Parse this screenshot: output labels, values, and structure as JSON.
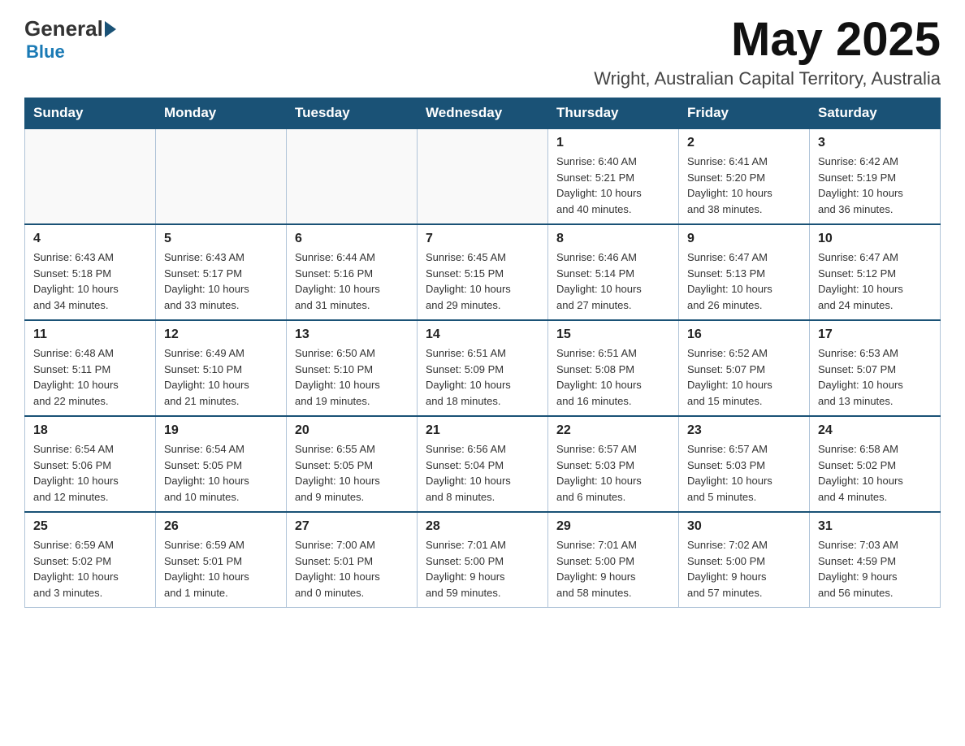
{
  "logo": {
    "general": "General",
    "blue": "Blue"
  },
  "header": {
    "month": "May 2025",
    "location": "Wright, Australian Capital Territory, Australia"
  },
  "weekdays": [
    "Sunday",
    "Monday",
    "Tuesday",
    "Wednesday",
    "Thursday",
    "Friday",
    "Saturday"
  ],
  "weeks": [
    [
      {
        "day": "",
        "info": ""
      },
      {
        "day": "",
        "info": ""
      },
      {
        "day": "",
        "info": ""
      },
      {
        "day": "",
        "info": ""
      },
      {
        "day": "1",
        "info": "Sunrise: 6:40 AM\nSunset: 5:21 PM\nDaylight: 10 hours\nand 40 minutes."
      },
      {
        "day": "2",
        "info": "Sunrise: 6:41 AM\nSunset: 5:20 PM\nDaylight: 10 hours\nand 38 minutes."
      },
      {
        "day": "3",
        "info": "Sunrise: 6:42 AM\nSunset: 5:19 PM\nDaylight: 10 hours\nand 36 minutes."
      }
    ],
    [
      {
        "day": "4",
        "info": "Sunrise: 6:43 AM\nSunset: 5:18 PM\nDaylight: 10 hours\nand 34 minutes."
      },
      {
        "day": "5",
        "info": "Sunrise: 6:43 AM\nSunset: 5:17 PM\nDaylight: 10 hours\nand 33 minutes."
      },
      {
        "day": "6",
        "info": "Sunrise: 6:44 AM\nSunset: 5:16 PM\nDaylight: 10 hours\nand 31 minutes."
      },
      {
        "day": "7",
        "info": "Sunrise: 6:45 AM\nSunset: 5:15 PM\nDaylight: 10 hours\nand 29 minutes."
      },
      {
        "day": "8",
        "info": "Sunrise: 6:46 AM\nSunset: 5:14 PM\nDaylight: 10 hours\nand 27 minutes."
      },
      {
        "day": "9",
        "info": "Sunrise: 6:47 AM\nSunset: 5:13 PM\nDaylight: 10 hours\nand 26 minutes."
      },
      {
        "day": "10",
        "info": "Sunrise: 6:47 AM\nSunset: 5:12 PM\nDaylight: 10 hours\nand 24 minutes."
      }
    ],
    [
      {
        "day": "11",
        "info": "Sunrise: 6:48 AM\nSunset: 5:11 PM\nDaylight: 10 hours\nand 22 minutes."
      },
      {
        "day": "12",
        "info": "Sunrise: 6:49 AM\nSunset: 5:10 PM\nDaylight: 10 hours\nand 21 minutes."
      },
      {
        "day": "13",
        "info": "Sunrise: 6:50 AM\nSunset: 5:10 PM\nDaylight: 10 hours\nand 19 minutes."
      },
      {
        "day": "14",
        "info": "Sunrise: 6:51 AM\nSunset: 5:09 PM\nDaylight: 10 hours\nand 18 minutes."
      },
      {
        "day": "15",
        "info": "Sunrise: 6:51 AM\nSunset: 5:08 PM\nDaylight: 10 hours\nand 16 minutes."
      },
      {
        "day": "16",
        "info": "Sunrise: 6:52 AM\nSunset: 5:07 PM\nDaylight: 10 hours\nand 15 minutes."
      },
      {
        "day": "17",
        "info": "Sunrise: 6:53 AM\nSunset: 5:07 PM\nDaylight: 10 hours\nand 13 minutes."
      }
    ],
    [
      {
        "day": "18",
        "info": "Sunrise: 6:54 AM\nSunset: 5:06 PM\nDaylight: 10 hours\nand 12 minutes."
      },
      {
        "day": "19",
        "info": "Sunrise: 6:54 AM\nSunset: 5:05 PM\nDaylight: 10 hours\nand 10 minutes."
      },
      {
        "day": "20",
        "info": "Sunrise: 6:55 AM\nSunset: 5:05 PM\nDaylight: 10 hours\nand 9 minutes."
      },
      {
        "day": "21",
        "info": "Sunrise: 6:56 AM\nSunset: 5:04 PM\nDaylight: 10 hours\nand 8 minutes."
      },
      {
        "day": "22",
        "info": "Sunrise: 6:57 AM\nSunset: 5:03 PM\nDaylight: 10 hours\nand 6 minutes."
      },
      {
        "day": "23",
        "info": "Sunrise: 6:57 AM\nSunset: 5:03 PM\nDaylight: 10 hours\nand 5 minutes."
      },
      {
        "day": "24",
        "info": "Sunrise: 6:58 AM\nSunset: 5:02 PM\nDaylight: 10 hours\nand 4 minutes."
      }
    ],
    [
      {
        "day": "25",
        "info": "Sunrise: 6:59 AM\nSunset: 5:02 PM\nDaylight: 10 hours\nand 3 minutes."
      },
      {
        "day": "26",
        "info": "Sunrise: 6:59 AM\nSunset: 5:01 PM\nDaylight: 10 hours\nand 1 minute."
      },
      {
        "day": "27",
        "info": "Sunrise: 7:00 AM\nSunset: 5:01 PM\nDaylight: 10 hours\nand 0 minutes."
      },
      {
        "day": "28",
        "info": "Sunrise: 7:01 AM\nSunset: 5:00 PM\nDaylight: 9 hours\nand 59 minutes."
      },
      {
        "day": "29",
        "info": "Sunrise: 7:01 AM\nSunset: 5:00 PM\nDaylight: 9 hours\nand 58 minutes."
      },
      {
        "day": "30",
        "info": "Sunrise: 7:02 AM\nSunset: 5:00 PM\nDaylight: 9 hours\nand 57 minutes."
      },
      {
        "day": "31",
        "info": "Sunrise: 7:03 AM\nSunset: 4:59 PM\nDaylight: 9 hours\nand 56 minutes."
      }
    ]
  ]
}
